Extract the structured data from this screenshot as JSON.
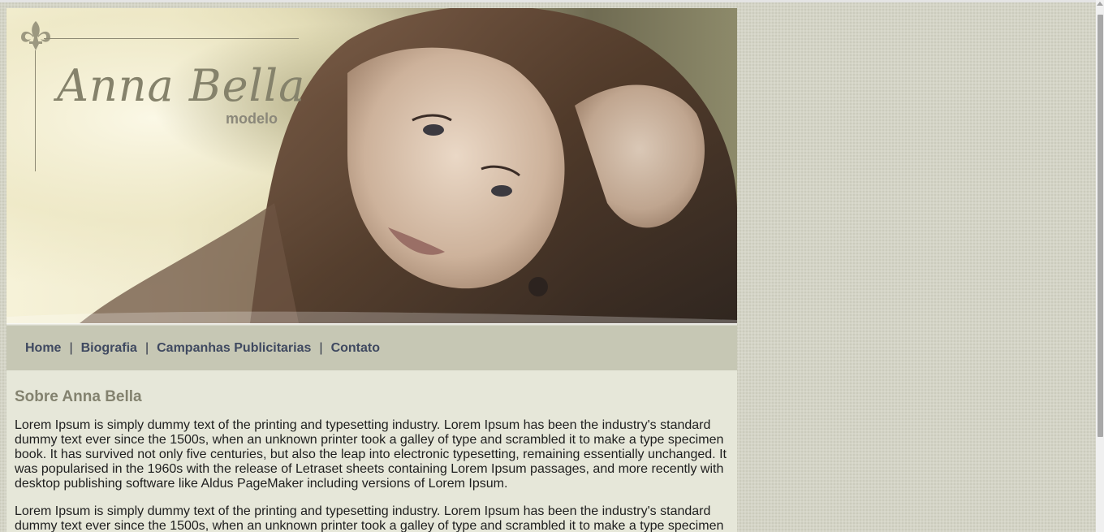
{
  "header": {
    "logo_name": "Anna Bella",
    "logo_subtitle": "modelo"
  },
  "nav": {
    "items": [
      {
        "label": "Home"
      },
      {
        "label": "Biografia"
      },
      {
        "label": "Campanhas Publicitarias"
      },
      {
        "label": "Contato"
      }
    ],
    "separator": "|"
  },
  "main": {
    "heading": "Sobre Anna Bella",
    "paragraphs": [
      "Lorem Ipsum is simply dummy text of the printing and typesetting industry. Lorem Ipsum has been the industry's standard dummy text ever since the 1500s, when an unknown printer took a galley of type and scrambled it to make a type specimen book. It has survived not only five centuries, but also the leap into electronic typesetting, remaining essentially unchanged. It was popularised in the 1960s with the release of Letraset sheets containing Lorem Ipsum passages, and more recently with desktop publishing software like Aldus PageMaker including versions of Lorem Ipsum.",
      "Lorem Ipsum is simply dummy text of the printing and typesetting industry. Lorem Ipsum has been the industry's standard dummy text ever since the 1500s, when an unknown printer took a galley of type and scrambled it to make a type specimen book. It has survived not only five centuries, but also the leap into electronic typesetting, remaining essentially unchanged."
    ]
  },
  "colors": {
    "page_background": "#d4d4c6",
    "content_background": "#e6e7d9",
    "nav_background": "#c6c7b4",
    "nav_link": "#3f4960",
    "heading": "#83826f"
  },
  "icons": {
    "logo_ornament": "fleur-de-lis-icon",
    "scroll_up": "scroll-up-arrow-icon"
  }
}
